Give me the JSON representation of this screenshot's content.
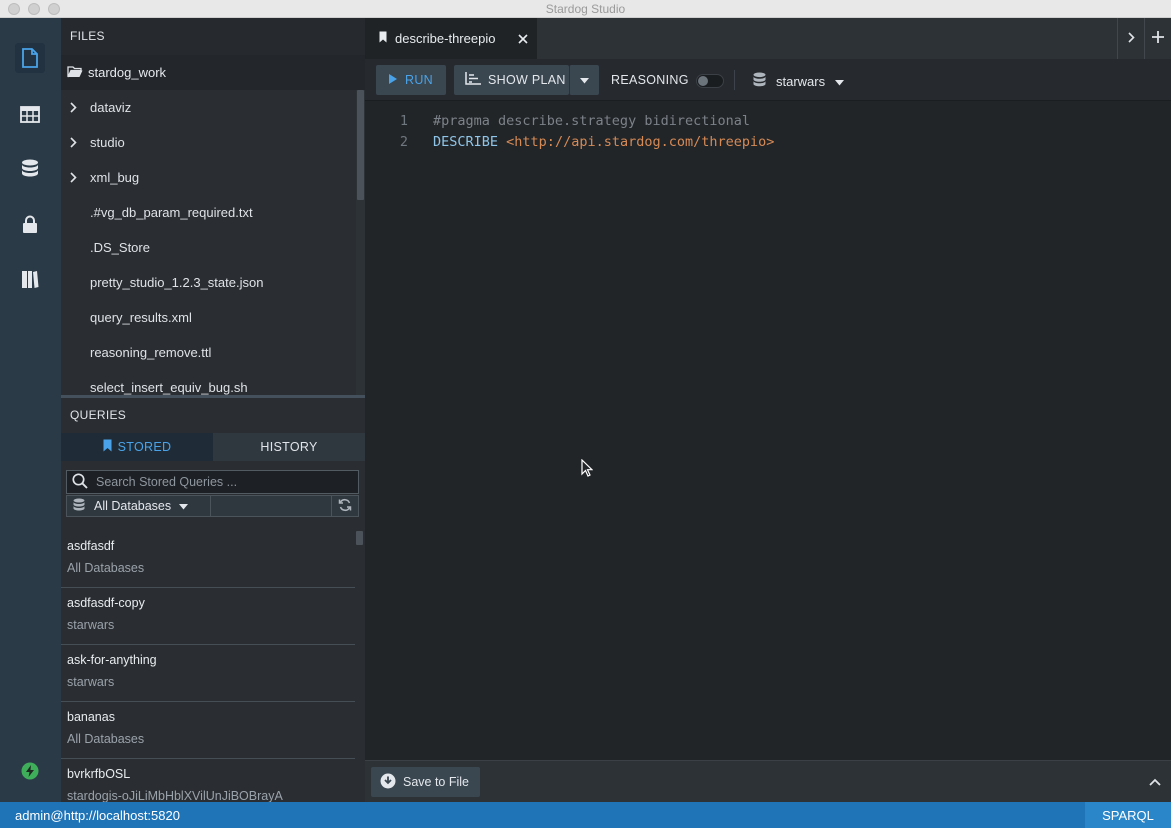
{
  "window": {
    "title": "Stardog Studio"
  },
  "files": {
    "header": "FILES",
    "root": "stardog_work",
    "items": [
      {
        "label": "dataviz",
        "type": "folder"
      },
      {
        "label": "studio",
        "type": "folder"
      },
      {
        "label": "xml_bug",
        "type": "folder"
      },
      {
        "label": ".#vg_db_param_required.txt",
        "type": "file"
      },
      {
        "label": ".DS_Store",
        "type": "file"
      },
      {
        "label": "pretty_studio_1.2.3_state.json",
        "type": "file"
      },
      {
        "label": "query_results.xml",
        "type": "file"
      },
      {
        "label": "reasoning_remove.ttl",
        "type": "file"
      },
      {
        "label": "select_insert_equiv_bug.sh",
        "type": "file"
      }
    ]
  },
  "queries": {
    "header": "QUERIES",
    "tabs": {
      "stored": "STORED",
      "history": "HISTORY"
    },
    "search_placeholder": "Search Stored Queries ...",
    "db_filter": "All Databases",
    "items": [
      {
        "name": "asdfasdf",
        "db": "All Databases"
      },
      {
        "name": "asdfasdf-copy",
        "db": "starwars"
      },
      {
        "name": "ask-for-anything",
        "db": "starwars"
      },
      {
        "name": "bananas",
        "db": "All Databases"
      },
      {
        "name": "bvrkrfbOSL",
        "db": "stardogis-oJiLiMbHblXVilUnJiBOBrayA"
      }
    ]
  },
  "editor": {
    "tab_title": "describe-threepio",
    "toolbar": {
      "run": "RUN",
      "show_plan": "SHOW PLAN",
      "reasoning": "REASONING",
      "reasoning_on": false,
      "database": "starwars"
    },
    "lines": [
      {
        "num": "1",
        "parts": [
          {
            "text": "#pragma describe.strategy bidirectional",
            "kind": "comment"
          }
        ]
      },
      {
        "num": "2",
        "parts": [
          {
            "text": "DESCRIBE",
            "kind": "keyword"
          },
          {
            "text": " ",
            "kind": "plain"
          },
          {
            "text": "<http://api.stardog.com/threepio>",
            "kind": "iri"
          }
        ]
      }
    ]
  },
  "results": {
    "save_label": "Save to File"
  },
  "status": {
    "connection": "admin@http://localhost:5820",
    "language": "SPARQL"
  },
  "colors": {
    "accent": "#4aa3e8",
    "status_bar": "#1f74b8",
    "iri": "#d68a56",
    "keyword": "#8fc5e8"
  }
}
